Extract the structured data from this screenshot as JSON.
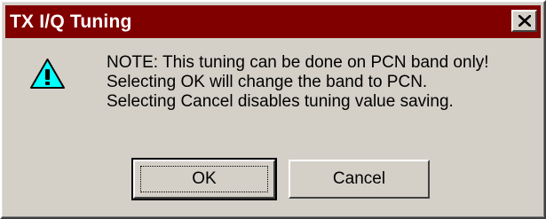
{
  "window": {
    "title": "TX I/Q Tuning",
    "close_icon": "close-icon"
  },
  "message": {
    "icon": "warning-icon",
    "lines": [
      "NOTE: This tuning can be done on PCN band only!",
      "Selecting OK will change the band to PCN.",
      "Selecting Cancel disables tuning value saving."
    ]
  },
  "buttons": {
    "ok_label": "OK",
    "cancel_label": "Cancel"
  },
  "colors": {
    "titlebar": "#800000",
    "dialog_face": "#d4d0c8",
    "warning_fill": "#00ffff"
  }
}
